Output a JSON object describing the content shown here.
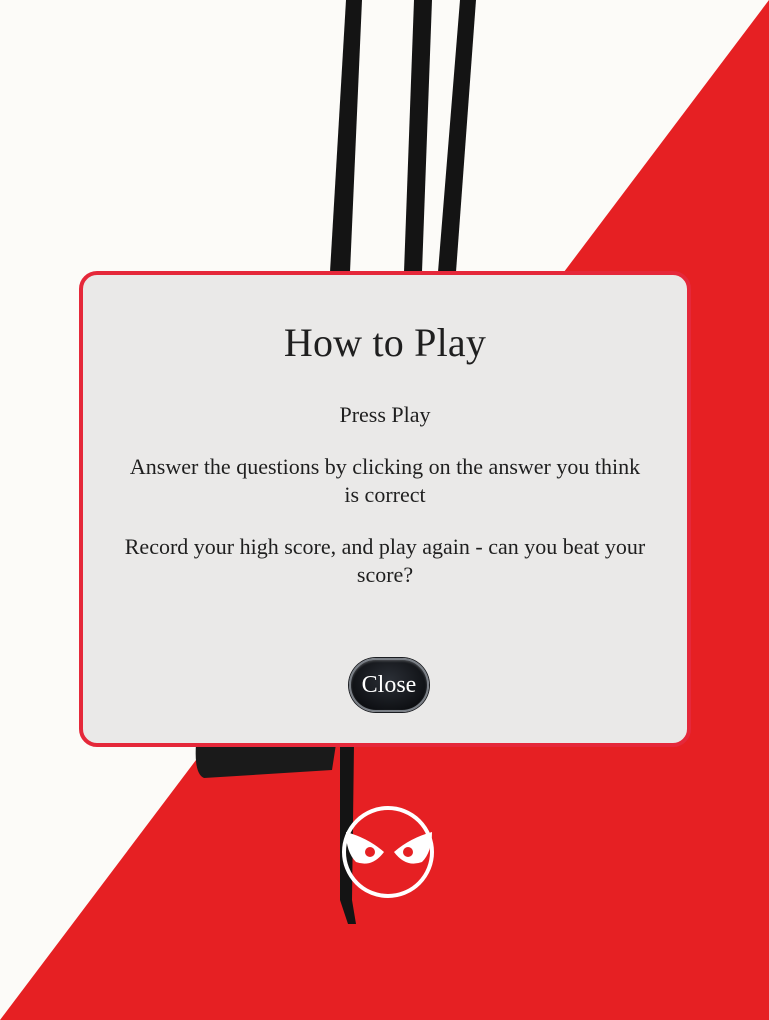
{
  "modal": {
    "title": "How to Play",
    "steps": [
      "Press Play",
      "Answer the questions by clicking on the answer you think is correct",
      "Record your high score, and play again - can you beat your score?"
    ],
    "close_label": "Close"
  },
  "theme": {
    "accent": "#e5283a",
    "background_light": "#fcfbf8",
    "background_red": "#e62023",
    "modal_background": "#eae9e8",
    "button_background": "#111317"
  },
  "icons": {
    "backdrop_art": "owl-eyes-icon"
  }
}
